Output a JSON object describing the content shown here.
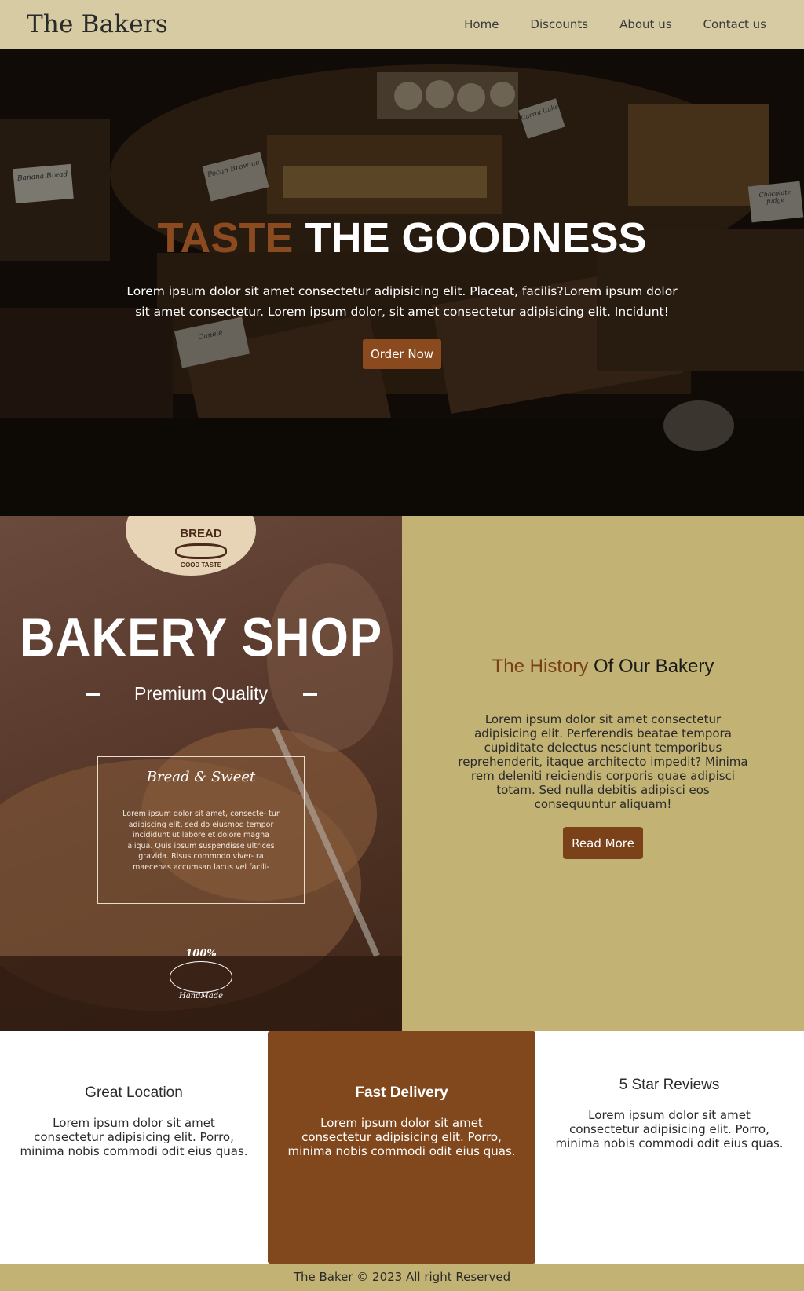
{
  "header": {
    "brand": "The Bakers",
    "nav": [
      "Home",
      "Discounts",
      "About us",
      "Contact us"
    ]
  },
  "hero": {
    "title_accent": "TASTE",
    "title_rest": "THE GOODNESS",
    "text": "Lorem ipsum dolor sit amet consectetur adipisicing elit. Placeat, facilis?Lorem ipsum dolor sit amet consectetur. Lorem ipsum dolor, sit amet consectetur adipisicing elit. Incidunt!",
    "button": "Order Now",
    "sign_labels": [
      "Banana Bread",
      "Pecan Brownie",
      "Carrot Cake",
      "Canelé",
      "Chocolate fudge"
    ]
  },
  "poster": {
    "badge_top": "BREAD",
    "badge_bottom": "GOOD TASTE",
    "title": "BAKERY SHOP",
    "subtitle": "Premium Quality",
    "box_title": "Bread & Sweet",
    "box_text": "Lorem ipsum dolor sit amet, consecte- tur adipiscing elit, sed do eiusmod tempor incididunt ut labore et dolore magna aliqua. Quis ipsum suspendisse ultrices gravida. Risus commodo viver- ra maecenas accumsan lacus vel facili-",
    "stamp_top": "100%",
    "stamp_bottom": "HandMade"
  },
  "history": {
    "title_accent": "The History",
    "title_rest": "Of Our Bakery",
    "text": "Lorem ipsum dolor sit amet consectetur adipisicing elit. Perferendis beatae tempora cupiditate delectus nesciunt temporibus reprehenderit, itaque architecto impedit? Minima rem deleniti reiciendis corporis quae adipisci totam. Sed nulla debitis adipisci eos consequuntur aliquam!",
    "button": "Read More"
  },
  "features": [
    {
      "title": "Great Location",
      "text": "Lorem ipsum dolor sit amet consectetur adipisicing elit. Porro, minima nobis commodi odit eius quas."
    },
    {
      "title": "Fast Delivery",
      "text": "Lorem ipsum dolor sit amet consectetur adipisicing elit. Porro, minima nobis commodi odit eius quas."
    },
    {
      "title": "5 Star Reviews",
      "text": "Lorem ipsum dolor sit amet consectetur adipisicing elit. Porro, minima nobis commodi odit eius quas."
    }
  ],
  "footer": {
    "text": "The Baker © 2023 All right Reserved"
  },
  "colors": {
    "header_bg": "#d6cba2",
    "accent_brown": "#82481d",
    "history_bg": "#c2b374"
  }
}
